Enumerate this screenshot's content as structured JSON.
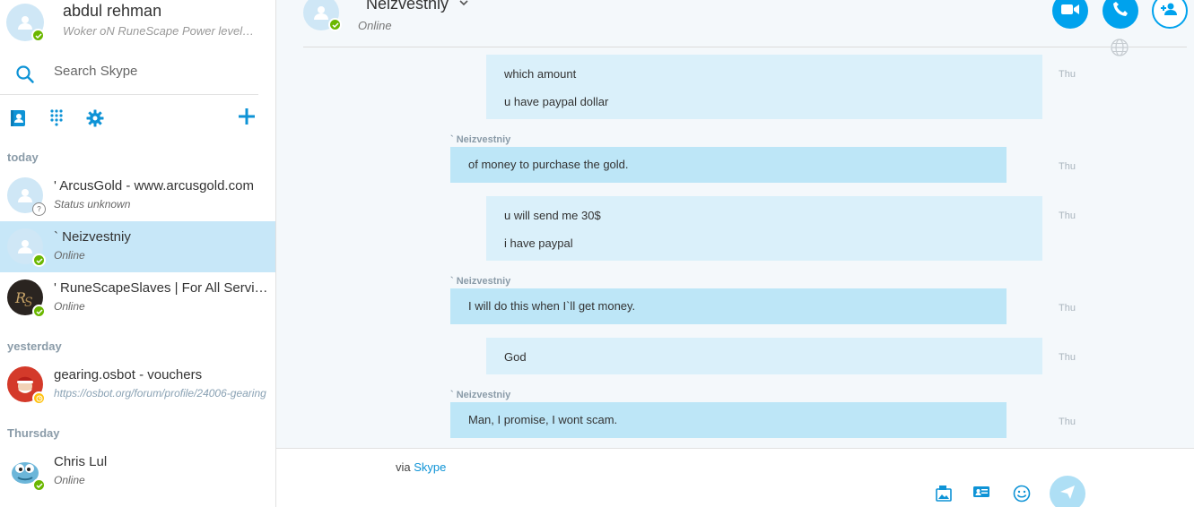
{
  "me": {
    "name": "abdul rehman",
    "mood": "Woker oN RuneScape Power leveling"
  },
  "search": {
    "placeholder": "Search Skype"
  },
  "sections": {
    "today": "today",
    "yesterday": "yesterday",
    "thursday": "Thursday"
  },
  "contacts": [
    {
      "name": "' ArcusGold - www.arcusgold.com",
      "sub": "Status unknown",
      "status": "unknown"
    },
    {
      "name": "` Neizvestniy",
      "sub": "Online",
      "status": "online",
      "selected": true
    },
    {
      "name": "' RuneScapeSlaves | For All Services",
      "sub": "Online",
      "status": "online"
    },
    {
      "name": "gearing.osbot - vouchers",
      "sub": "https://osbot.org/forum/profile/24006-gearing",
      "status": "away"
    },
    {
      "name": "Chris Lul",
      "sub": "Online",
      "status": "online"
    }
  ],
  "conversation": {
    "name": "Neizvestniy",
    "status": "Online",
    "messages": [
      {
        "dir": "out",
        "lines": [
          "which amount",
          "u have paypal dollar"
        ],
        "time": "Thu"
      },
      {
        "dir": "in",
        "sender": "` Neizvestniy",
        "lines": [
          "of money to purchase the gold."
        ],
        "time": "Thu"
      },
      {
        "dir": "out",
        "lines": [
          "u will send me 30$",
          "i have paypal"
        ],
        "time": "Thu"
      },
      {
        "dir": "in",
        "sender": "` Neizvestniy",
        "lines": [
          "I will do this when I`ll get money."
        ],
        "time": "Thu"
      },
      {
        "dir": "out",
        "lines": [
          "God"
        ],
        "time": "Thu"
      },
      {
        "dir": "in",
        "sender": "` Neizvestniy",
        "lines": [
          "Man, I promise, I wont scam."
        ],
        "time": "Thu"
      }
    ]
  },
  "composer": {
    "via_prefix": "via",
    "via_link": "Skype"
  },
  "colors": {
    "accent": "#00a2ed",
    "online": "#6bb700",
    "away": "#ffc20e",
    "selected": "#c7e7f8"
  },
  "icons": [
    "search-icon",
    "contacts-icon",
    "dialpad-icon",
    "gear-icon",
    "plus-icon",
    "video-icon",
    "phone-icon",
    "add-person-icon",
    "globe-icon",
    "image-icon",
    "contact-card-icon",
    "emoji-icon",
    "send-icon"
  ]
}
